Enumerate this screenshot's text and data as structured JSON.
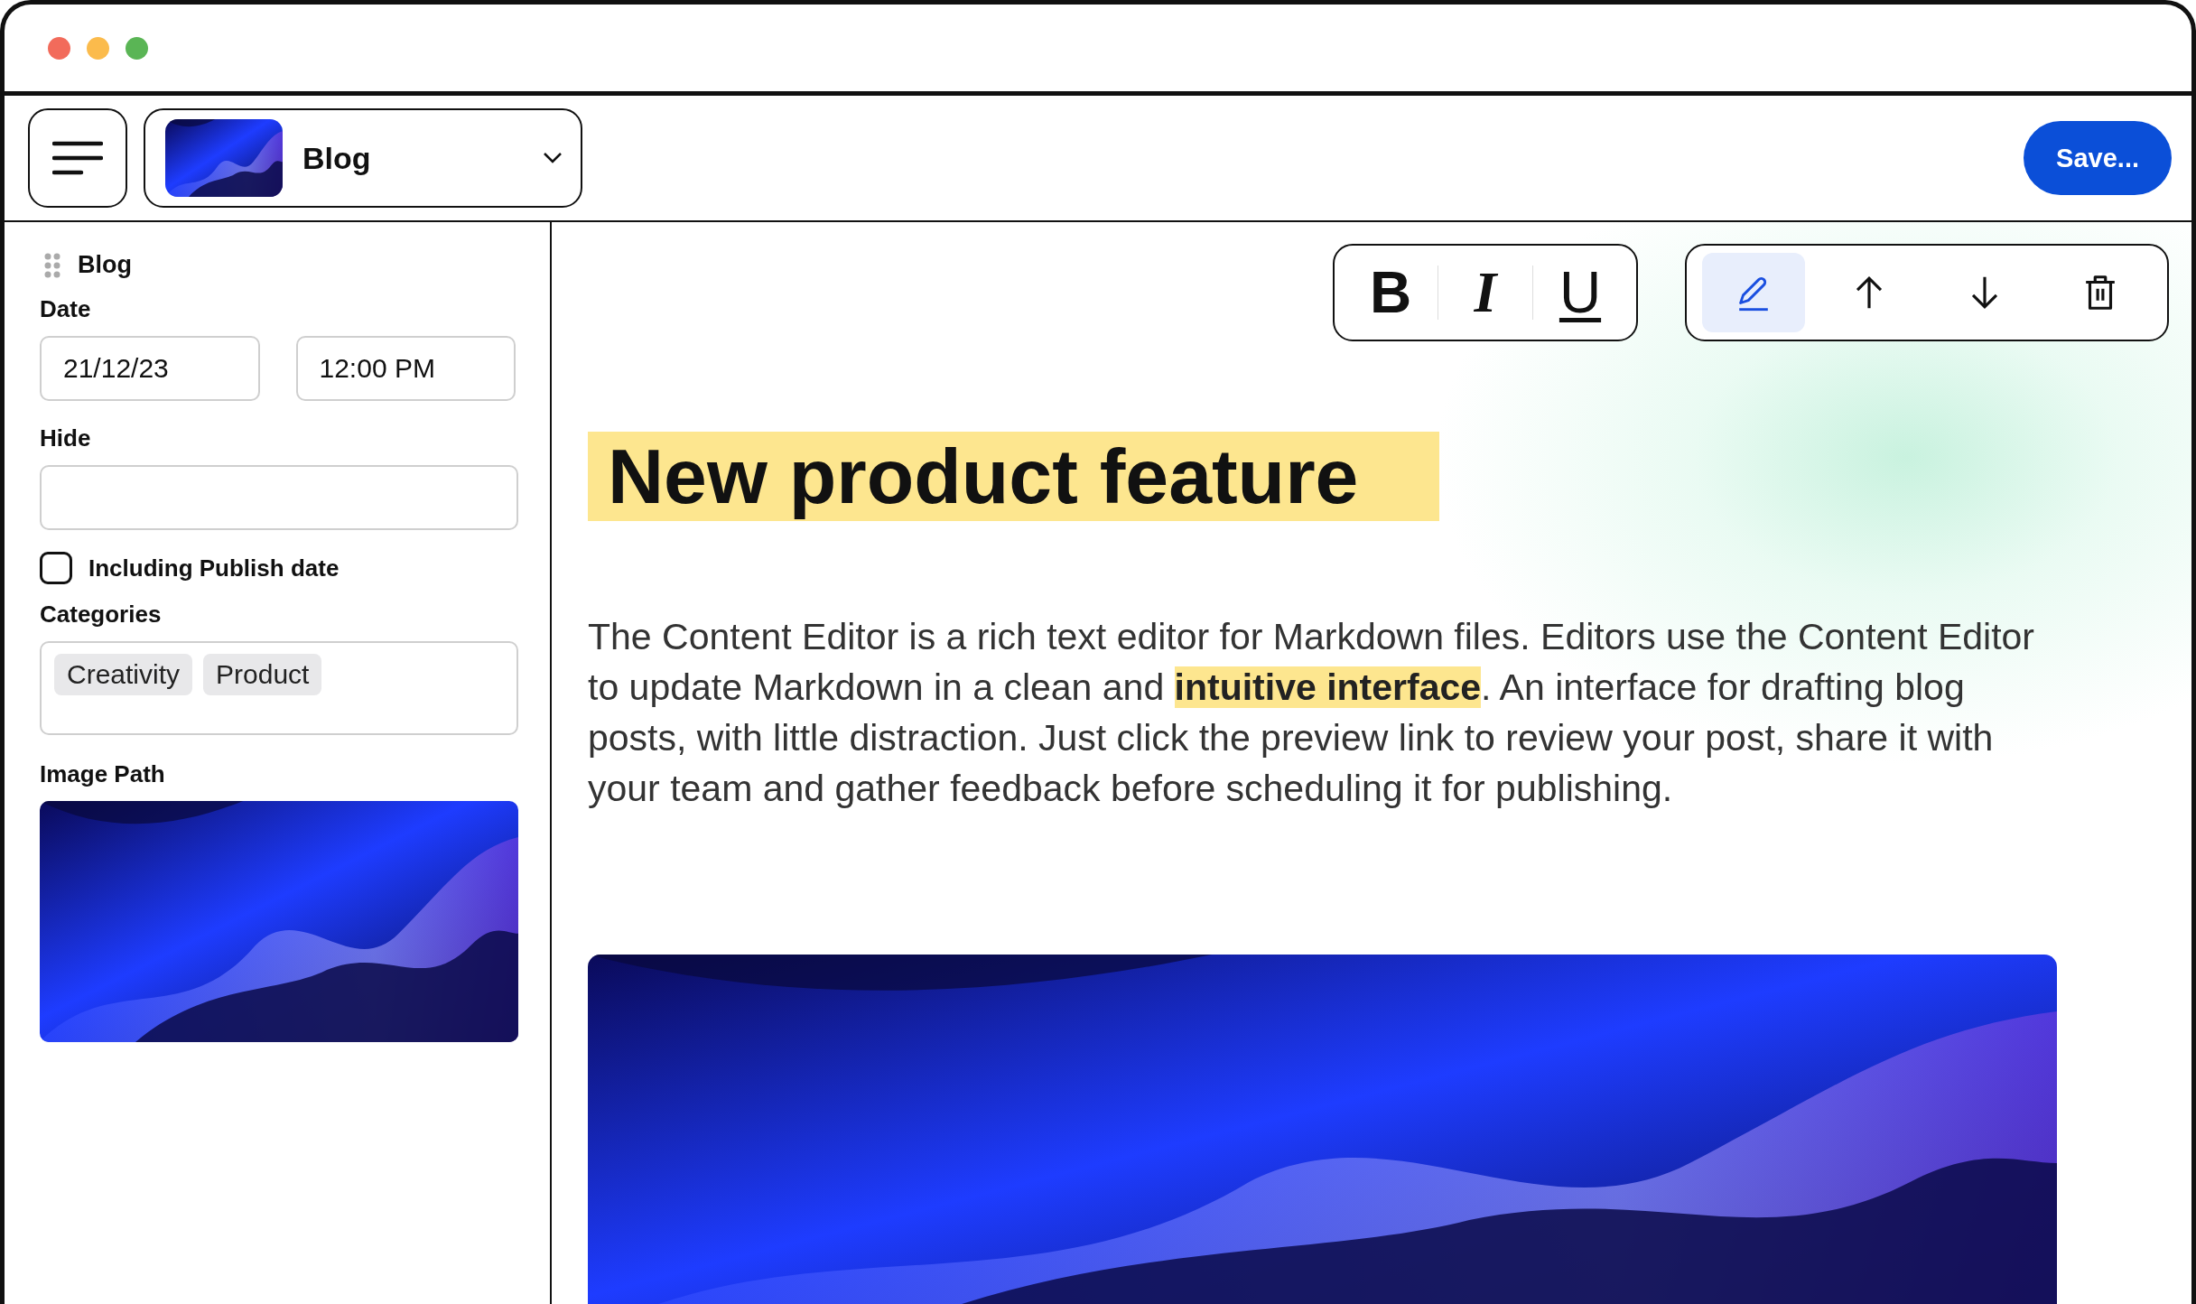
{
  "header": {
    "document_title": "Blog",
    "save_button": "Save..."
  },
  "sidebar": {
    "title": "Blog",
    "date": {
      "label": "Date",
      "date_value": "21/12/23",
      "time_value": "12:00 PM"
    },
    "hide": {
      "label": "Hide"
    },
    "include_publish_date": {
      "label": "Including Publish date",
      "checked": false
    },
    "categories": {
      "label": "Categories",
      "tags": [
        "Creativity",
        "Product"
      ]
    },
    "image_path": {
      "label": "Image Path"
    }
  },
  "format_toolbar": [
    {
      "label": "B",
      "kind": "bold"
    },
    {
      "label": "I",
      "kind": "italic"
    },
    {
      "label": "U",
      "kind": "underline"
    }
  ],
  "block_toolbar": [
    {
      "kind": "edit",
      "selected": true
    },
    {
      "kind": "up",
      "selected": false
    },
    {
      "kind": "down",
      "selected": false
    },
    {
      "kind": "delete",
      "selected": false
    }
  ],
  "editor": {
    "heading": "New product feature",
    "body": "The Content Editor is a rich text editor for Markdown files. Editors use the Content Editor to update Markdown in a clean and **intuitive interface**. An interface for drafting blog posts, with little distraction. Just click the preview link to review your post, share it with your team and gather feedback before scheduling it for publishing."
  }
}
